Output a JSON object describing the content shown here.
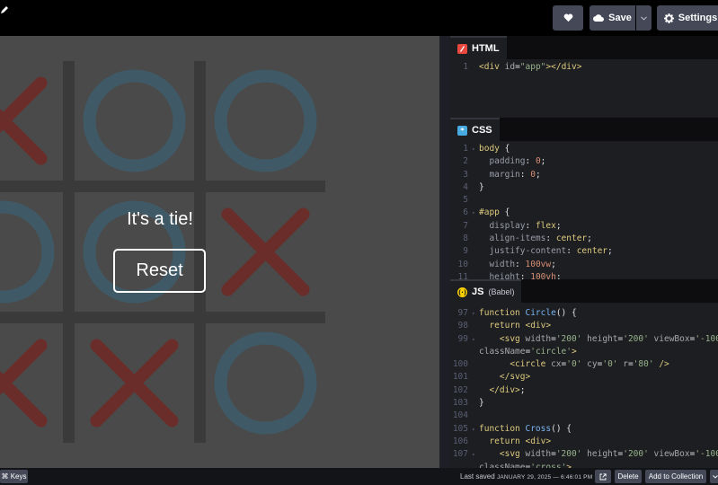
{
  "toolbar": {
    "save_label": "Save",
    "settings_label": "Settings"
  },
  "preview": {
    "message": "It's a tie!",
    "reset_label": "Reset",
    "board": [
      "X",
      "O",
      "O",
      "O",
      "O",
      "X",
      "X",
      "X",
      "O"
    ],
    "colors": {
      "x": "#6b2d2a",
      "o": "#3f5a66",
      "grid": "#3a3a3a",
      "cell": "#4a4a4a"
    }
  },
  "editors": {
    "html": {
      "title": "HTML",
      "lines": [
        {
          "n": "1",
          "fold": false,
          "tokens": [
            [
              "t-tag",
              "<div "
            ],
            [
              "t-attr",
              "id"
            ],
            [
              "t-punc",
              "="
            ],
            [
              "t-str",
              "\"app\""
            ],
            [
              "t-tag",
              "></div>"
            ]
          ]
        }
      ]
    },
    "css": {
      "title": "CSS",
      "lines": [
        {
          "n": "1",
          "fold": true,
          "tokens": [
            [
              "t-sel",
              "body"
            ],
            [
              "t-punc",
              " {"
            ]
          ]
        },
        {
          "n": "2",
          "fold": false,
          "tokens": [
            [
              "t-prop",
              "  padding"
            ],
            [
              "t-punc",
              ": "
            ],
            [
              "t-num",
              "0"
            ],
            [
              "t-punc",
              ";"
            ]
          ]
        },
        {
          "n": "3",
          "fold": false,
          "tokens": [
            [
              "t-prop",
              "  margin"
            ],
            [
              "t-punc",
              ": "
            ],
            [
              "t-num",
              "0"
            ],
            [
              "t-punc",
              ";"
            ]
          ]
        },
        {
          "n": "4",
          "fold": false,
          "tokens": [
            [
              "t-punc",
              "}"
            ]
          ]
        },
        {
          "n": "5",
          "fold": false,
          "tokens": []
        },
        {
          "n": "6",
          "fold": true,
          "tokens": [
            [
              "t-sel",
              "#app"
            ],
            [
              "t-punc",
              " {"
            ]
          ]
        },
        {
          "n": "7",
          "fold": false,
          "tokens": [
            [
              "t-prop",
              "  display"
            ],
            [
              "t-punc",
              ": "
            ],
            [
              "t-kw",
              "flex"
            ],
            [
              "t-punc",
              ";"
            ]
          ]
        },
        {
          "n": "8",
          "fold": false,
          "tokens": [
            [
              "t-prop",
              "  align-items"
            ],
            [
              "t-punc",
              ": "
            ],
            [
              "t-kw",
              "center"
            ],
            [
              "t-punc",
              ";"
            ]
          ]
        },
        {
          "n": "9",
          "fold": false,
          "tokens": [
            [
              "t-prop",
              "  justify-content"
            ],
            [
              "t-punc",
              ": "
            ],
            [
              "t-kw",
              "center"
            ],
            [
              "t-punc",
              ";"
            ]
          ]
        },
        {
          "n": "10",
          "fold": false,
          "tokens": [
            [
              "t-prop",
              "  width"
            ],
            [
              "t-punc",
              ": "
            ],
            [
              "t-num",
              "100vw"
            ],
            [
              "t-punc",
              ";"
            ]
          ]
        },
        {
          "n": "11",
          "fold": false,
          "tokens": [
            [
              "t-prop",
              "  height"
            ],
            [
              "t-punc",
              ": "
            ],
            [
              "t-num",
              "100vh"
            ],
            [
              "t-punc",
              ";"
            ]
          ]
        }
      ]
    },
    "js": {
      "title": "JS",
      "subtitle": "(Babel)",
      "lines": [
        {
          "n": "97",
          "fold": true,
          "tokens": [
            [
              "t-kw",
              "function "
            ],
            [
              "t-fn",
              "Circle"
            ],
            [
              "t-punc",
              "() {"
            ]
          ]
        },
        {
          "n": "98",
          "fold": false,
          "tokens": [
            [
              "t-kw",
              "  return "
            ],
            [
              "t-tag",
              "<div>"
            ]
          ]
        },
        {
          "n": "99",
          "fold": true,
          "tokens": [
            [
              "t-tag",
              "    <svg "
            ],
            [
              "t-attr",
              "width"
            ],
            [
              "t-punc",
              "="
            ],
            [
              "t-str",
              "'200' "
            ],
            [
              "t-attr",
              "height"
            ],
            [
              "t-punc",
              "="
            ],
            [
              "t-str",
              "'200' "
            ],
            [
              "t-attr",
              "viewBox"
            ],
            [
              "t-punc",
              "="
            ],
            [
              "t-str",
              "'-100"
            ]
          ]
        },
        {
          "n": "",
          "fold": false,
          "tokens": [
            [
              "t-attr",
              "className"
            ],
            [
              "t-punc",
              "="
            ],
            [
              "t-str",
              "'circle'"
            ],
            [
              "t-tag",
              ">"
            ]
          ]
        },
        {
          "n": "100",
          "fold": false,
          "tokens": [
            [
              "t-tag",
              "      <circle "
            ],
            [
              "t-attr",
              "cx"
            ],
            [
              "t-punc",
              "="
            ],
            [
              "t-str",
              "'0' "
            ],
            [
              "t-attr",
              "cy"
            ],
            [
              "t-punc",
              "="
            ],
            [
              "t-str",
              "'0' "
            ],
            [
              "t-attr",
              "r"
            ],
            [
              "t-punc",
              "="
            ],
            [
              "t-str",
              "'80' "
            ],
            [
              "t-tag",
              "/>"
            ]
          ]
        },
        {
          "n": "101",
          "fold": false,
          "tokens": [
            [
              "t-tag",
              "    </svg>"
            ]
          ]
        },
        {
          "n": "102",
          "fold": false,
          "tokens": [
            [
              "t-tag",
              "  </div>"
            ],
            [
              "t-punc",
              ";"
            ]
          ]
        },
        {
          "n": "103",
          "fold": false,
          "tokens": [
            [
              "t-punc",
              "}"
            ]
          ]
        },
        {
          "n": "104",
          "fold": false,
          "tokens": []
        },
        {
          "n": "105",
          "fold": true,
          "tokens": [
            [
              "t-kw",
              "function "
            ],
            [
              "t-fn",
              "Cross"
            ],
            [
              "t-punc",
              "() {"
            ]
          ]
        },
        {
          "n": "106",
          "fold": false,
          "tokens": [
            [
              "t-kw",
              "  return "
            ],
            [
              "t-tag",
              "<div>"
            ]
          ]
        },
        {
          "n": "107",
          "fold": true,
          "tokens": [
            [
              "t-tag",
              "    <svg "
            ],
            [
              "t-attr",
              "width"
            ],
            [
              "t-punc",
              "="
            ],
            [
              "t-str",
              "'200' "
            ],
            [
              "t-attr",
              "height"
            ],
            [
              "t-punc",
              "="
            ],
            [
              "t-str",
              "'200' "
            ],
            [
              "t-attr",
              "viewBox"
            ],
            [
              "t-punc",
              "="
            ],
            [
              "t-str",
              "'-100"
            ]
          ]
        },
        {
          "n": "",
          "fold": false,
          "tokens": [
            [
              "t-attr",
              "className"
            ],
            [
              "t-punc",
              "="
            ],
            [
              "t-str",
              "'cross'"
            ],
            [
              "t-tag",
              ">"
            ]
          ]
        }
      ]
    }
  },
  "footer": {
    "keys_label": "⌘ Keys",
    "last_saved_label": "Last saved",
    "last_saved_date": "JANUARY 29, 2025 — 6:46:01 PM",
    "delete_label": "Delete",
    "collection_label": "Add to Collection"
  },
  "icons": {
    "pencil": "pencil-icon",
    "heart": "heart-icon",
    "cloud": "cloud-icon",
    "chevron": "chevron-down-icon",
    "gear": "gear-icon",
    "external": "external-link-icon"
  }
}
